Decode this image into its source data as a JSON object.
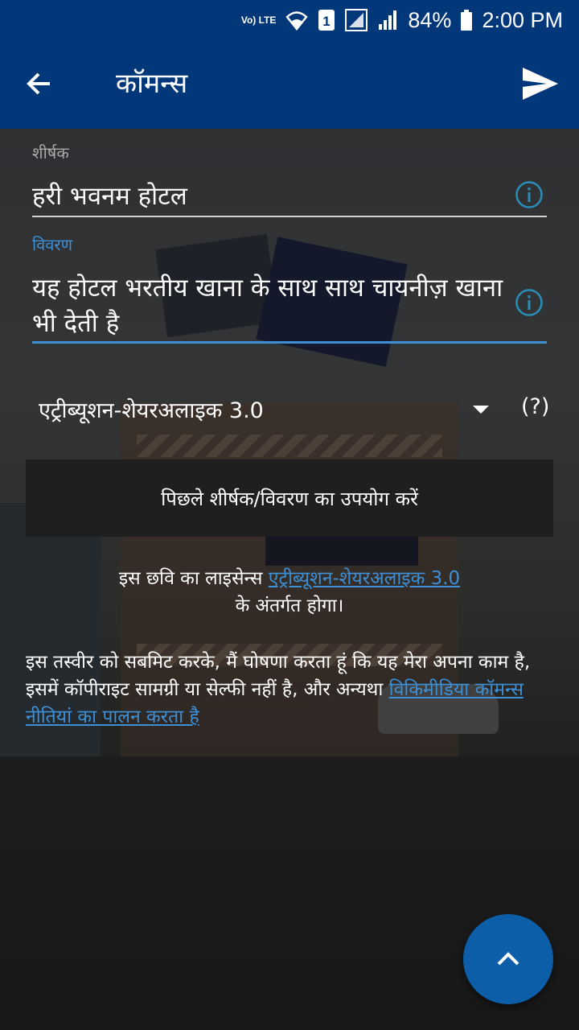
{
  "status_bar": {
    "network_label": "Vo) LTE",
    "sim_slot": "1",
    "battery": "84%",
    "time": "2:00 PM"
  },
  "app_bar": {
    "title": "कॉमन्स",
    "back_icon": "arrow-back-icon",
    "send_icon": "send-icon"
  },
  "form": {
    "title_label": "शीर्षक",
    "title_value": "हरी भवनम होटल",
    "description_label": "विवरण",
    "description_value": "यह होटल भरतीय खाना के साथ साथ चायनीज़ खाना भी देती है",
    "license_selected": "एट्रीब्यूशन-शेयरअलाइक 3.0",
    "license_help": "(?)",
    "previous_button": "पिछले शीर्षक/विवरण का उपयोग करें"
  },
  "license_note": {
    "prefix": "इस छवि का लाइसेन्स ",
    "link": "एट्रीब्यूशन-शेयरअलाइक 3.0",
    "suffix": "के अंतर्गत होगा।"
  },
  "declaration": {
    "text": "इस तस्वीर को सबमिट करके, मैं घोषणा करता हूं कि यह मेरा अपना काम है, इसमें कॉपीराइट सामग्री या सेल्फी नहीं है, और अन्यथा ",
    "link": "विकिमीडिया कॉमन्स नीतियां का पालन करता है"
  },
  "colors": {
    "app_bar": "#02387a",
    "accent": "#0d5ea8",
    "link": "#3d8fd6",
    "info_icon": "#2a8fb8"
  }
}
